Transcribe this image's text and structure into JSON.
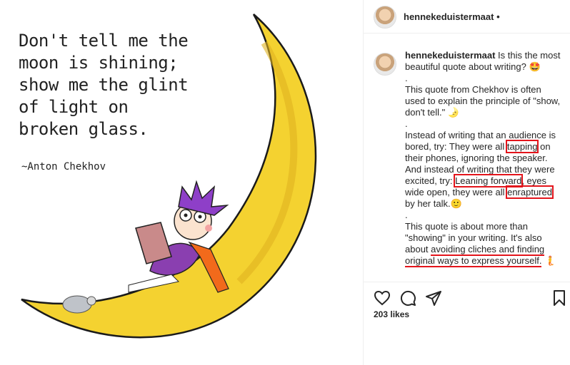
{
  "post": {
    "quote_lines": [
      "Don't tell me the",
      "moon is shining;",
      "show me the glint",
      "of light on",
      "broken glass."
    ],
    "quote_author": "~Anton Chekhov"
  },
  "header": {
    "username": "hennekeduistermaat",
    "follow_dot": "•"
  },
  "caption": {
    "username": "hennekeduistermaat",
    "intro": " Is this the most beautiful quote about writing? 🤩",
    "dot1": ".",
    "line2": "This quote from Chekhov is often used to explain the principle of \"show, don't tell.\" 🌛",
    "dot2": ".",
    "p3_a": "Instead of writing that an audience is bored, try: They were all ",
    "p3_hl": "tapping",
    "p3_b": " on their phones, ignoring the speaker. And instead of writing that they were excited, try: ",
    "p3_hl2": "Leaning forward",
    "p3_c": ", eyes wide open, they were all ",
    "p3_hl3": "enraptured",
    "p3_d": " by her talk.🙂",
    "dot3": ".",
    "p4_a": "This quote is about more than \"showing\" in your writing. It's also about ",
    "p4_ul": "avoiding cliches and finding original ways to express yourself.",
    "p4_b": " 🧜"
  },
  "engagement": {
    "likes": "203 likes"
  }
}
